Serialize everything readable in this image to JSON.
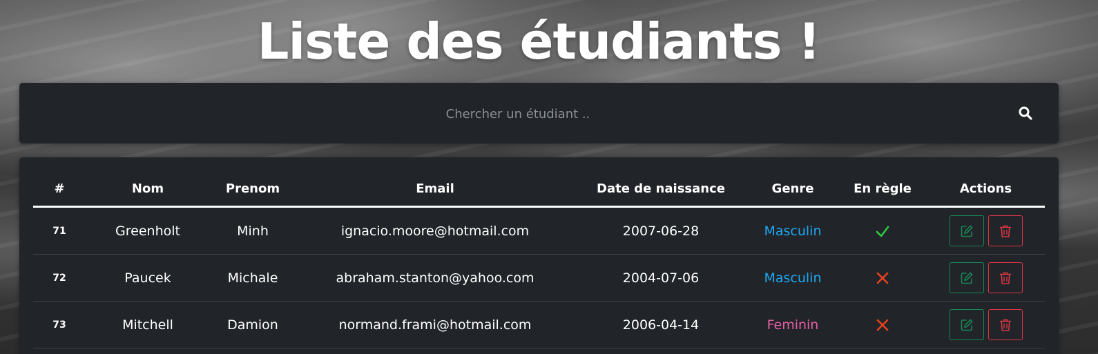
{
  "page": {
    "title": "Liste des étudiants !"
  },
  "search": {
    "placeholder": "Chercher un étudiant ..",
    "value": "",
    "icon": "search-icon"
  },
  "table": {
    "headers": {
      "id": "#",
      "nom": "Nom",
      "prenom": "Prenom",
      "email": "Email",
      "date": "Date de naissance",
      "genre": "Genre",
      "regle": "En règle",
      "actions": "Actions"
    },
    "rows": [
      {
        "id": "71",
        "nom": "Greenholt",
        "prenom": "Minh",
        "email": "ignacio.moore@hotmail.com",
        "date": "2007-06-28",
        "genre": "Masculin",
        "regle": true,
        "regle_icon": "check-icon",
        "edit_icon": "edit-icon",
        "delete_icon": "trash-icon"
      },
      {
        "id": "72",
        "nom": "Paucek",
        "prenom": "Michale",
        "email": "abraham.stanton@yahoo.com",
        "date": "2004-07-06",
        "genre": "Masculin",
        "regle": false,
        "regle_icon": "cross-icon",
        "edit_icon": "edit-icon",
        "delete_icon": "trash-icon"
      },
      {
        "id": "73",
        "nom": "Mitchell",
        "prenom": "Damion",
        "email": "normand.frami@hotmail.com",
        "date": "2006-04-14",
        "genre": "Feminin",
        "regle": false,
        "regle_icon": "cross-icon",
        "edit_icon": "edit-icon",
        "delete_icon": "trash-icon"
      }
    ]
  },
  "colors": {
    "card_background": "#212529",
    "masculin": "#1ea7f2",
    "feminin": "#e75ea6",
    "check": "#2ecc40",
    "cross": "#e8421f",
    "edit_button": "#198754",
    "delete_button": "#dc3545"
  }
}
